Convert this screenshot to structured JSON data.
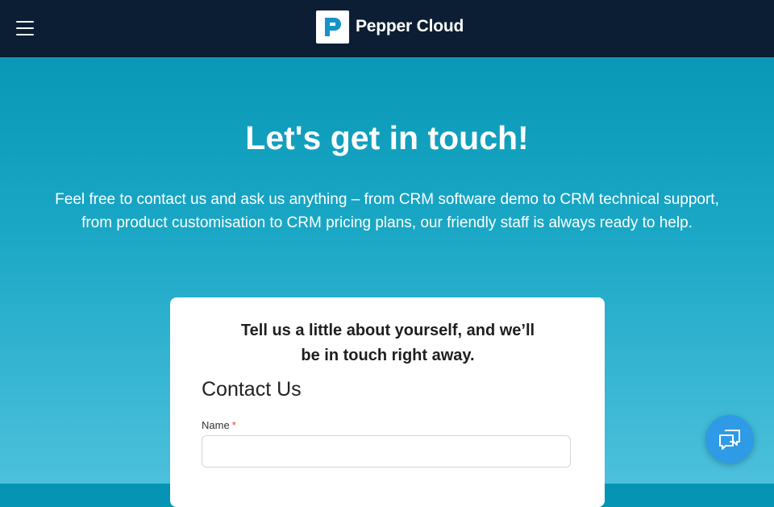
{
  "header": {
    "menu_icon": "hamburger-menu-icon",
    "logo_icon": "pepper-cloud-logo-icon",
    "logo_text": "Pepper Cloud"
  },
  "hero": {
    "title": "Let's get in touch!",
    "description": "Feel free to contact us and ask us anything – from CRM software demo to CRM technical support, from product customisation to CRM pricing plans, our friendly staff is always ready to help."
  },
  "form": {
    "tagline_line1": "Tell us a little about yourself, and we’ll",
    "tagline_line2": "be in touch right away.",
    "heading": "Contact Us",
    "name_label": "Name",
    "required_mark": "*",
    "name_value": "",
    "name_placeholder": ""
  },
  "chat_widget": {
    "icon": "chat-bubbles-icon"
  },
  "colors": {
    "header_bg": "#0c1e33",
    "hero_gradient_top": "#0593b3",
    "hero_gradient_bottom": "#4cc0dc",
    "chat_button": "#2f9ae6",
    "required": "#e0432e"
  }
}
